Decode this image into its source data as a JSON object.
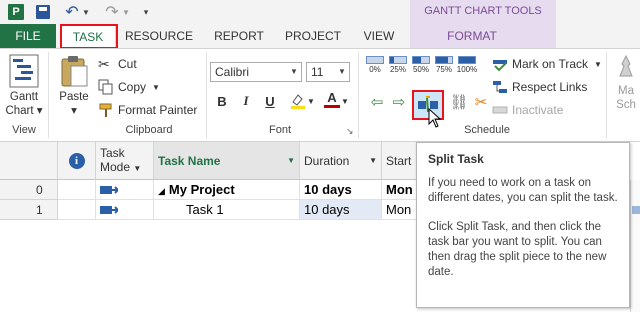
{
  "quick_access": {
    "app_icon": "P",
    "icons": [
      "project-app-icon",
      "save-icon",
      "undo-icon",
      "redo-icon"
    ]
  },
  "context_header": {
    "title": "GANTT CHART TOOLS"
  },
  "tabs": {
    "file": "FILE",
    "task": "TASK",
    "resource": "RESOURCE",
    "report": "REPORT",
    "project": "PROJECT",
    "view": "VIEW",
    "format": "FORMAT"
  },
  "ribbon": {
    "view_group": {
      "button_line1": "Gantt",
      "button_line2": "Chart",
      "label": "View"
    },
    "clipboard_group": {
      "paste": "Paste",
      "cut": "Cut",
      "copy": "Copy",
      "format_painter": "Format Painter",
      "label": "Clipboard"
    },
    "font_group": {
      "font_name": "Calibri",
      "font_size": "11",
      "bold": "B",
      "italic": "I",
      "underline": "U",
      "font_color_letter": "A",
      "label": "Font"
    },
    "schedule_group": {
      "percent_labels": [
        "0%",
        "25%",
        "50%",
        "75%",
        "100%"
      ],
      "percent_values": [
        0,
        0.25,
        0.5,
        0.75,
        1
      ],
      "mark_on_track": "Mark on Track",
      "respect_links": "Respect Links",
      "inactivate": "Inactivate",
      "label": "Schedule"
    },
    "manually_schedule_partial": {
      "line1": "Ma",
      "line2": "Sch"
    }
  },
  "table": {
    "headers": {
      "task_mode_line1": "Task",
      "task_mode_line2": "Mode",
      "task_name": "Task Name",
      "duration": "Duration",
      "start": "Start"
    },
    "rows": [
      {
        "id": "0",
        "name": "My Project",
        "duration": "10 days",
        "start": "Mon"
      },
      {
        "id": "1",
        "name": "Task 1",
        "duration": "10 days",
        "start": "Mon"
      }
    ]
  },
  "tooltip": {
    "title": "Split Task",
    "p1": "If you need to work on a task on different dates, you can split the task.",
    "p2": "Click Split Task, and then click the task bar you want to split. You can then drag the split piece to the new date."
  },
  "colors": {
    "accent": "#217346",
    "context": "#7a4b94",
    "highlight_box": "#e8131d"
  }
}
